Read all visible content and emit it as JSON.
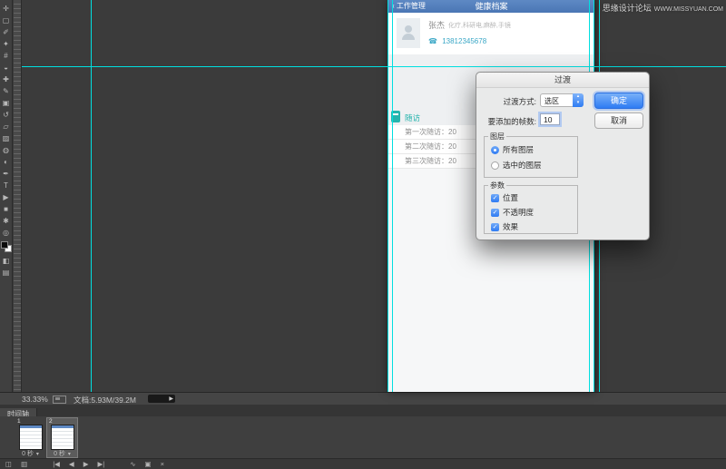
{
  "watermark": {
    "cn": "思缘设计论坛",
    "en": "WWW.MISSYUAN.COM"
  },
  "icons": {
    "back_arrow": "‹",
    "phone": "☎",
    "caret_up": "▴",
    "caret_down": "▾",
    "check": "✓",
    "status_arrow": "▶",
    "frame_caret": "▾"
  },
  "toolbar": {
    "tools": [
      {
        "name": "move",
        "glyph": "✛"
      },
      {
        "name": "marquee",
        "glyph": "▢"
      },
      {
        "name": "lasso",
        "glyph": "✐"
      },
      {
        "name": "quick-select",
        "glyph": "✦"
      },
      {
        "name": "crop",
        "glyph": "#"
      },
      {
        "name": "eyedropper",
        "glyph": "◒"
      },
      {
        "name": "healing-brush",
        "glyph": "✚"
      },
      {
        "name": "brush",
        "glyph": "✎"
      },
      {
        "name": "clone-stamp",
        "glyph": "▣"
      },
      {
        "name": "history-brush",
        "glyph": "↺"
      },
      {
        "name": "eraser",
        "glyph": "▱"
      },
      {
        "name": "gradient",
        "glyph": "▨"
      },
      {
        "name": "blur",
        "glyph": "◍"
      },
      {
        "name": "dodge",
        "glyph": "◐"
      },
      {
        "name": "pen",
        "glyph": "✒"
      },
      {
        "name": "type",
        "glyph": "T"
      },
      {
        "name": "path-select",
        "glyph": "▶"
      },
      {
        "name": "shape",
        "glyph": "■"
      },
      {
        "name": "hand",
        "glyph": "✱"
      },
      {
        "name": "zoom",
        "glyph": "◎"
      },
      {
        "name": "mask-mode",
        "glyph": "◧"
      },
      {
        "name": "screen-mode",
        "glyph": "▤"
      }
    ]
  },
  "mockup": {
    "header": {
      "back": "工作管理",
      "title": "健康档案"
    },
    "profile": {
      "name": "张杰",
      "desc": "化疗,科研电,麻醉,手镜",
      "phone": "13812345678"
    },
    "section": {
      "title": "随访",
      "items": [
        "第一次随访：20",
        "第二次随访：20",
        "第三次随访：20"
      ]
    }
  },
  "dialog": {
    "title": "过渡",
    "method_label": "过渡方式:",
    "method_value": "选区",
    "frames_label": "要添加的帧数:",
    "frames_value": "10",
    "ok_label": "确定",
    "cancel_label": "取消",
    "layers": {
      "legend": "图层",
      "options": [
        {
          "label": "所有图层",
          "selected": true
        },
        {
          "label": "选中的图层",
          "selected": false
        }
      ]
    },
    "params": {
      "legend": "参数",
      "options": [
        {
          "label": "位置",
          "checked": true
        },
        {
          "label": "不透明度",
          "checked": true
        },
        {
          "label": "效果",
          "checked": true
        }
      ]
    }
  },
  "statusbar": {
    "zoom": "33.33%",
    "doc": "文档:5.93M/39.2M"
  },
  "timeline": {
    "tab": "时间轴",
    "frames": [
      {
        "num": "1",
        "time": "0 秒"
      },
      {
        "num": "2",
        "time": "0 秒"
      }
    ],
    "controls": [
      {
        "name": "frame-options",
        "glyph": "◫"
      },
      {
        "name": "layout-options",
        "glyph": "▥"
      },
      {
        "name": "first-frame",
        "glyph": "|◀"
      },
      {
        "name": "prev-frame",
        "glyph": "◀"
      },
      {
        "name": "play",
        "glyph": "▶"
      },
      {
        "name": "next-frame",
        "glyph": "▶|"
      },
      {
        "name": "tween",
        "glyph": "∿"
      },
      {
        "name": "duplicate-frame",
        "glyph": "▣"
      },
      {
        "name": "delete-frame",
        "glyph": "×"
      }
    ]
  },
  "colors": {
    "accent_blue": "#2f7cf3",
    "mockup_header_blue": "#5380bd",
    "teal": "#26b4ad",
    "guide_cyan": "#00dfe0",
    "workspace_bg": "#3b3b3b",
    "dialog_bg": "#e9eaea",
    "phone_link": "#3aa7c6"
  }
}
